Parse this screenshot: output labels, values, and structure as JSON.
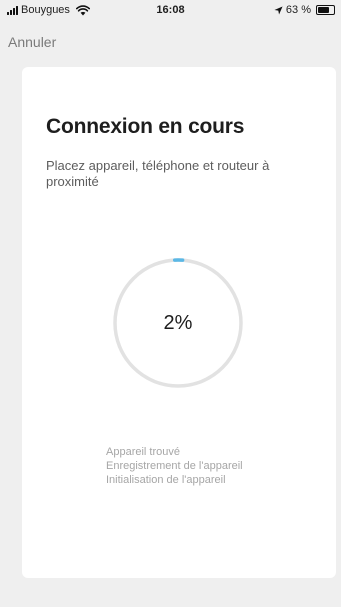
{
  "status_bar": {
    "carrier": "Bouygues",
    "time": "16:08",
    "battery_percent_label": "63 %",
    "battery_level": 0.63,
    "icons": [
      "signal-icon",
      "wifi-icon",
      "location-arrow-icon",
      "battery-icon"
    ]
  },
  "nav": {
    "cancel_label": "Annuler"
  },
  "card": {
    "title": "Connexion en cours",
    "subtitle": "Placez appareil, téléphone et routeur à proximité",
    "progress": {
      "value_label": "2%",
      "value": 2,
      "max": 100,
      "track_color": "#e2e2e2",
      "fill_color": "#5bb8e6"
    },
    "steps": [
      {
        "label": "Appareil trouvé"
      },
      {
        "label": "Enregistrement de l'appareil"
      },
      {
        "label": "Initialisation de l'appareil"
      }
    ]
  }
}
